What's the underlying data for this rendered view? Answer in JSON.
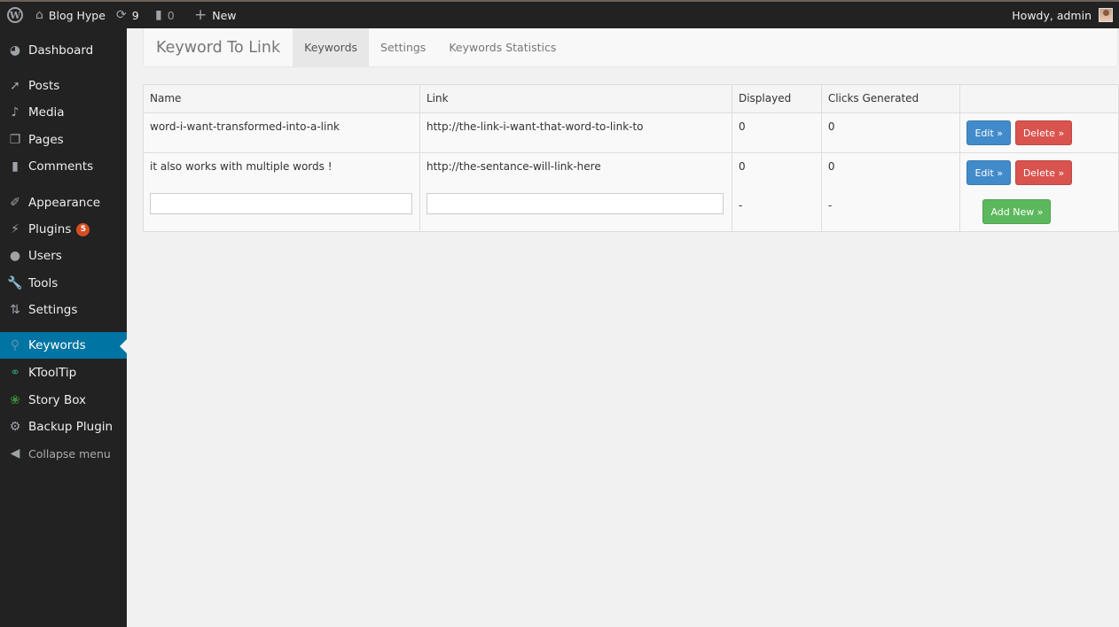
{
  "adminbar": {
    "site_name": "Blog Hype",
    "updates_count": "9",
    "comments_count": "0",
    "new_label": "New",
    "greeting": "Howdy, admin"
  },
  "sidebar": {
    "items": [
      {
        "label": "Dashboard",
        "icon": "dashboard-icon"
      },
      {
        "label": "Posts",
        "icon": "pin-icon"
      },
      {
        "label": "Media",
        "icon": "media-icon"
      },
      {
        "label": "Pages",
        "icon": "pages-icon"
      },
      {
        "label": "Comments",
        "icon": "comment-icon"
      },
      {
        "label": "Appearance",
        "icon": "paintbrush-icon"
      },
      {
        "label": "Plugins",
        "icon": "plug-icon",
        "badge": "5"
      },
      {
        "label": "Users",
        "icon": "user-icon"
      },
      {
        "label": "Tools",
        "icon": "wrench-icon"
      },
      {
        "label": "Settings",
        "icon": "sliders-icon"
      },
      {
        "label": "Keywords",
        "icon": "key-icon",
        "current": true
      },
      {
        "label": "KToolTip",
        "icon": "tag-icon"
      },
      {
        "label": "Story Box",
        "icon": "leaf-icon"
      },
      {
        "label": "Backup Plugin",
        "icon": "gear-icon"
      }
    ],
    "collapse_label": "Collapse menu"
  },
  "plugin_nav": {
    "brand": "Keyword To Link",
    "tabs": [
      {
        "label": "Keywords",
        "active": true
      },
      {
        "label": "Settings"
      },
      {
        "label": "Keywords Statistics"
      }
    ]
  },
  "keywords_table": {
    "headers": [
      "Name",
      "Link",
      "Displayed",
      "Clicks Generated",
      ""
    ],
    "rows": [
      {
        "name": "word-i-want-transformed-into-a-link",
        "link": "http://the-link-i-want-that-word-to-link-to",
        "displayed": "0",
        "clicks": "0"
      },
      {
        "name": "it also works with multiple words !",
        "link": "http://the-sentance-will-link-here",
        "displayed": "0",
        "clicks": "0"
      }
    ],
    "new_row": {
      "name_value": "",
      "link_value": "",
      "displayed": "-",
      "clicks": "-"
    },
    "edit_label": "Edit »",
    "delete_label": "Delete »",
    "add_label": "Add New »"
  },
  "colors": {
    "adminbar_bg": "#222222",
    "sidebar_current": "#0074a2",
    "badge": "#d54e21",
    "edit_button": "#428bca",
    "delete_button": "#d9534f",
    "add_button": "#5cb85c"
  }
}
